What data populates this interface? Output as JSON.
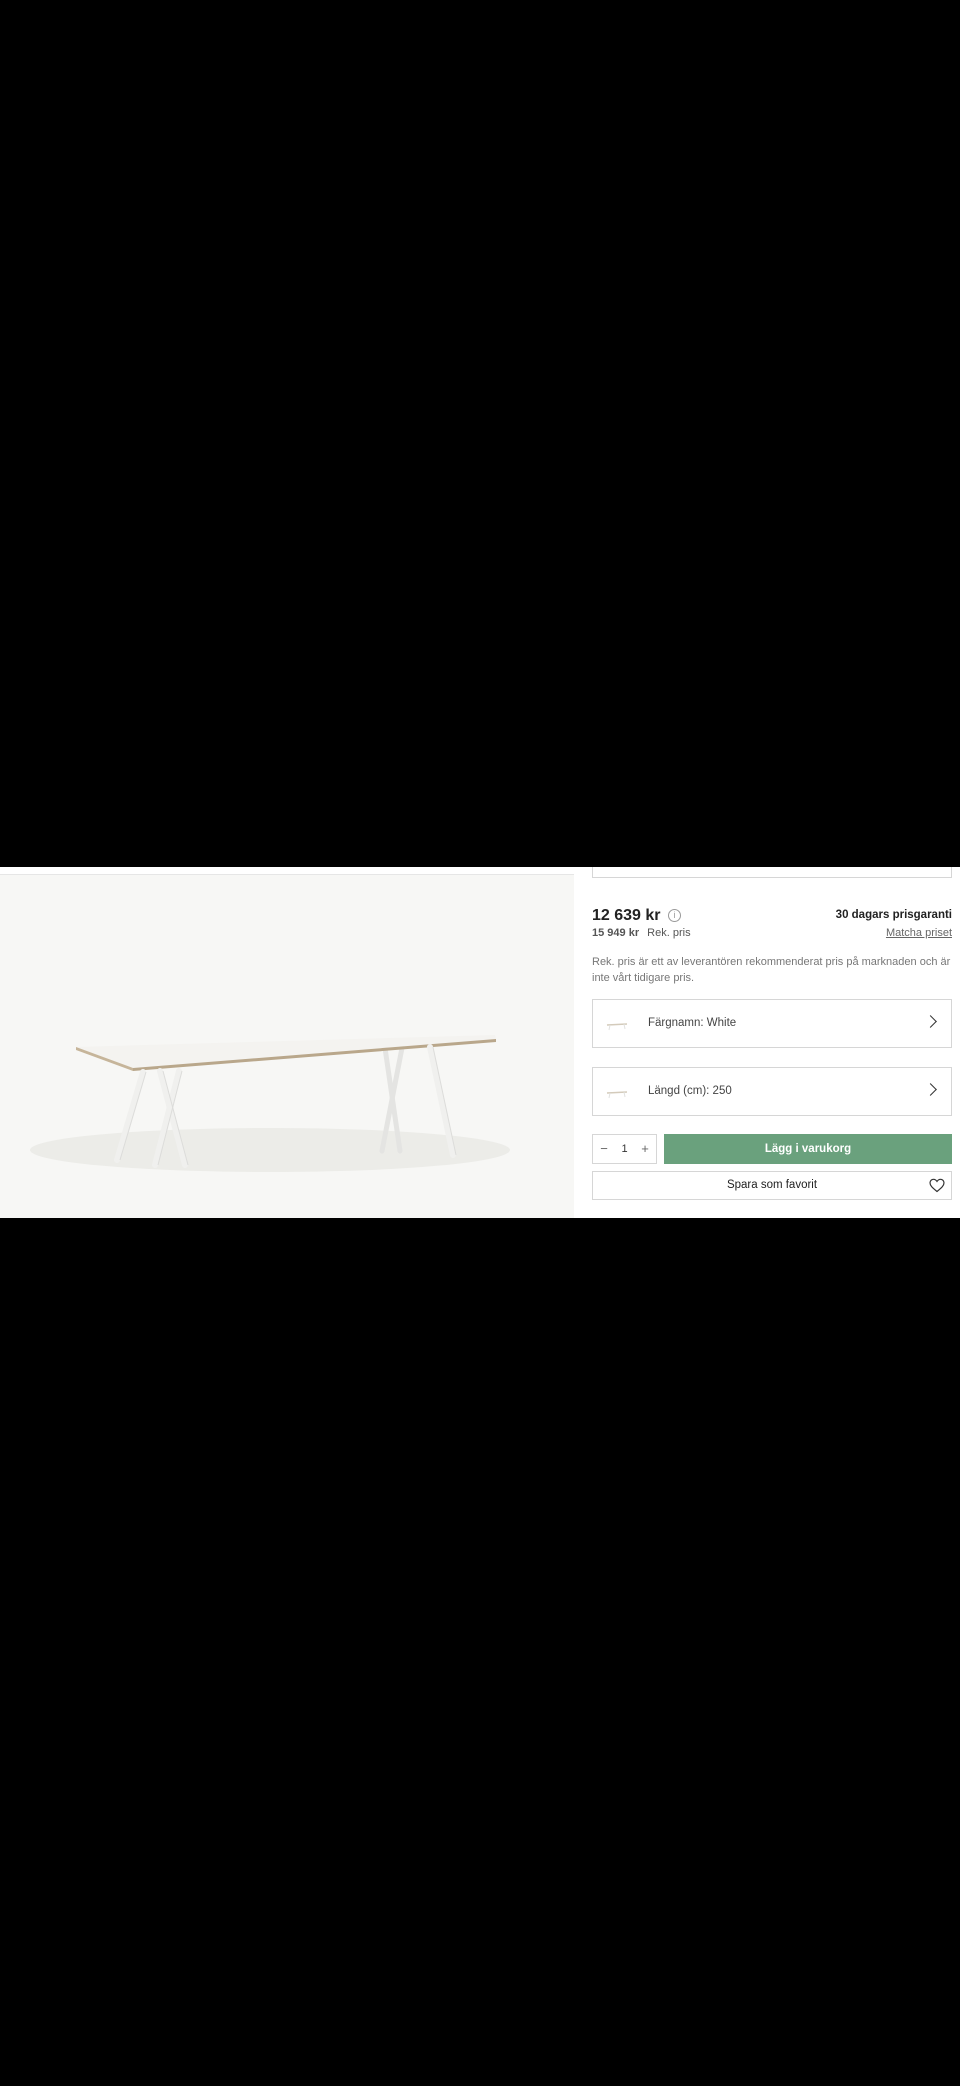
{
  "product": {
    "price": "12 639 kr",
    "info_icon": "info-icon",
    "recommended_price": "15 949 kr",
    "recommended_label": "Rek. pris",
    "guarantee_title": "30 dagars prisgaranti",
    "match_price_link": "Matcha priset",
    "price_note": "Rek. pris är ett av leverantören rekommenderat pris på marknaden och är inte vårt tidigare pris."
  },
  "options": [
    {
      "label": "Färgnamn: White",
      "icon": "chevron-right-icon"
    },
    {
      "label": "Längd (cm): 250",
      "icon": "chevron-right-icon"
    }
  ],
  "cart": {
    "quantity": "1",
    "decrement_icon": "minus-icon",
    "increment_icon": "plus-icon",
    "add_to_cart_label": "Lägg i varukorg"
  },
  "favorite": {
    "label": "Spara som favorit",
    "icon": "heart-icon"
  },
  "colors": {
    "accent_green": "#6aa17d",
    "background": "#000000",
    "panel": "#ffffff"
  }
}
